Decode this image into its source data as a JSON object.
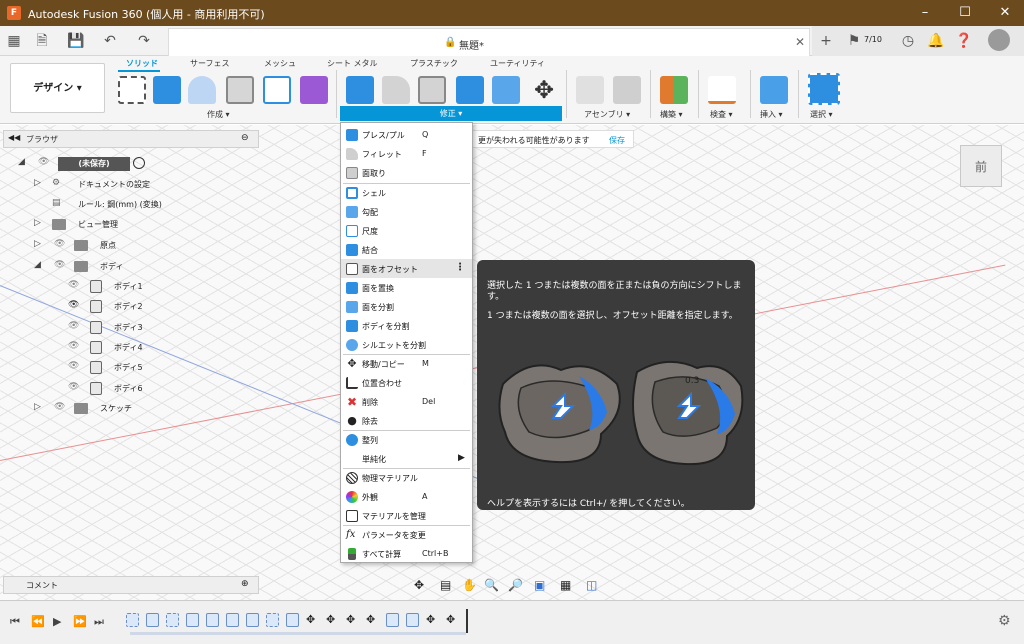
{
  "window": {
    "title": "Autodesk Fusion 360 (個人用 - 商用利用不可)",
    "app_icon": "F"
  },
  "document": {
    "title": "無題*",
    "jobs": "7/10"
  },
  "ribbon": {
    "workspace": "デザイン",
    "tabs": [
      "ソリッド",
      "サーフェス",
      "メッシュ",
      "シート メタル",
      "プラスチック",
      "ユーティリティ"
    ],
    "groups": [
      "作成",
      "修正",
      "アセンブリ",
      "構築",
      "検査",
      "挿入",
      "選択"
    ]
  },
  "browser": {
    "title": "ブラウザ",
    "root": "(未保存)",
    "items": [
      {
        "label": "ドキュメントの設定"
      },
      {
        "label": "ルール: 鋼(mm) (変換)"
      },
      {
        "label": "ビュー管理"
      },
      {
        "label": "原点"
      },
      {
        "label": "ボディ"
      },
      {
        "label": "ボディ1"
      },
      {
        "label": "ボディ2"
      },
      {
        "label": "ボディ3"
      },
      {
        "label": "ボディ4"
      },
      {
        "label": "ボディ5"
      },
      {
        "label": "ボディ6"
      },
      {
        "label": "スケッチ"
      }
    ]
  },
  "warning": {
    "text": "更が失われる可能性があります",
    "save": "保存"
  },
  "modify_menu": [
    {
      "label": "プレス/プル",
      "key": "Q"
    },
    {
      "label": "フィレット",
      "key": "F"
    },
    {
      "label": "面取り",
      "key": ""
    },
    {
      "label": "シェル",
      "key": ""
    },
    {
      "label": "勾配",
      "key": ""
    },
    {
      "label": "尺度",
      "key": ""
    },
    {
      "label": "結合",
      "key": ""
    },
    {
      "label": "面をオフセット",
      "key": ""
    },
    {
      "label": "面を置換",
      "key": ""
    },
    {
      "label": "面を分割",
      "key": ""
    },
    {
      "label": "ボディを分割",
      "key": ""
    },
    {
      "label": "シルエットを分割",
      "key": ""
    },
    {
      "label": "移動/コピー",
      "key": "M"
    },
    {
      "label": "位置合わせ",
      "key": ""
    },
    {
      "label": "削除",
      "key": "Del"
    },
    {
      "label": "除去",
      "key": ""
    },
    {
      "label": "整列",
      "key": ""
    },
    {
      "label": "単純化",
      "key": ""
    },
    {
      "label": "物理マテリアル",
      "key": ""
    },
    {
      "label": "外観",
      "key": "A"
    },
    {
      "label": "マテリアルを管理",
      "key": ""
    },
    {
      "label": "パラメータを変更",
      "key": ""
    },
    {
      "label": "すべて計算",
      "key": "Ctrl+B"
    }
  ],
  "tooltip": {
    "line1": "選択した 1 つまたは複数の面を正または負の方向にシフトします。",
    "line2": "1 つまたは複数の面を選択し、オフセット距離を指定します。",
    "help": "ヘルプを表示するには Ctrl+/ を押してください。",
    "dimension": "0.3"
  },
  "viewcube": {
    "face": "前"
  },
  "comment": {
    "title": "コメント"
  },
  "colors": {
    "accent": "#0696d7",
    "titlebar": "#6b4a1e"
  }
}
